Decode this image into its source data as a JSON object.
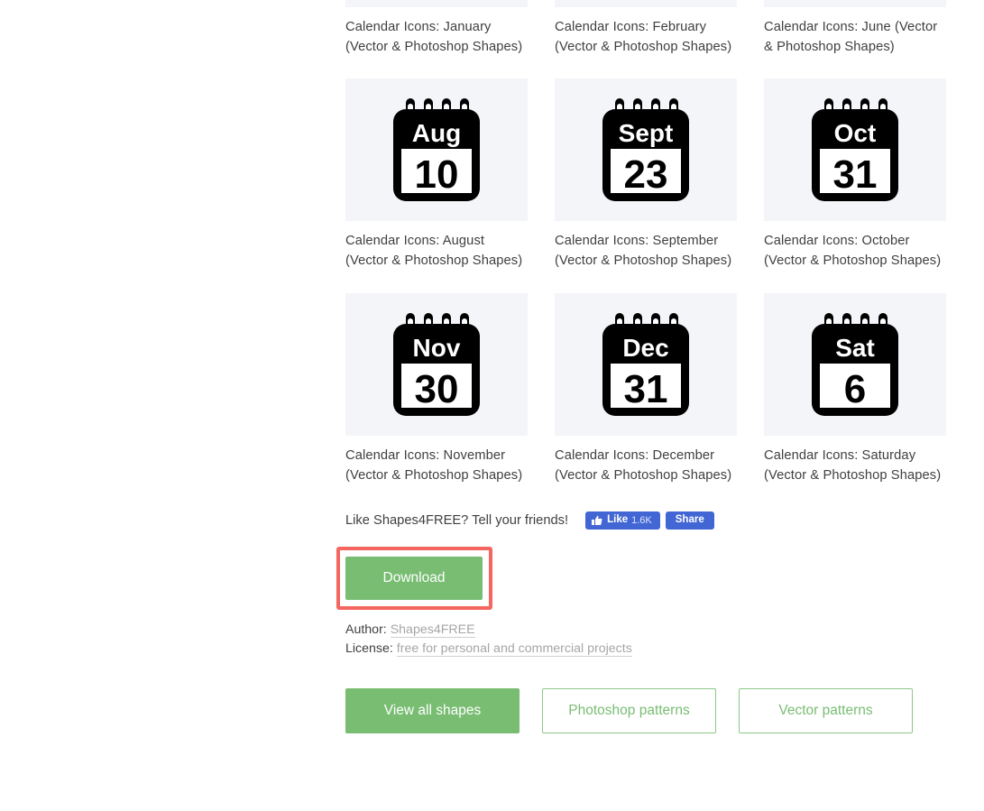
{
  "colors": {
    "green": "#78bd72",
    "green_outline_text": "#79bd73",
    "annotation_red": "#f4665f",
    "facebook_blue": "#4267d4",
    "thumb_bg": "#f4f5f8",
    "text": "#3f3f3f",
    "link_gray": "#a6a6a6"
  },
  "grid": {
    "clipped_row_captions": [
      "Calendar Icons: January (Vector & Photoshop Shapes)",
      "Calendar Icons: February (Vector & Photoshop Shapes)",
      "Calendar Icons: June (Vector & Photoshop Shapes)"
    ],
    "rows": [
      {
        "items": [
          {
            "month": "Aug",
            "day": "10",
            "caption": "Calendar Icons: August (Vector & Photoshop Shapes)"
          },
          {
            "month": "Sept",
            "day": "23",
            "caption": "Calendar Icons: September (Vector & Photoshop Shapes)"
          },
          {
            "month": "Oct",
            "day": "31",
            "caption": "Calendar Icons: October (Vector & Photoshop Shapes)"
          }
        ]
      },
      {
        "items": [
          {
            "month": "Nov",
            "day": "30",
            "caption": "Calendar Icons: November (Vector & Photoshop Shapes)"
          },
          {
            "month": "Dec",
            "day": "31",
            "caption": "Calendar Icons: December (Vector & Photoshop Shapes)"
          },
          {
            "month": "Sat",
            "day": "6",
            "caption": "Calendar Icons: Saturday (Vector & Photoshop Shapes)"
          }
        ]
      }
    ]
  },
  "social": {
    "prompt": "Like Shapes4FREE? Tell your friends!",
    "like_label": "Like",
    "like_count": "1.6K",
    "share_label": "Share",
    "thumbs_up_icon": "thumbs-up-icon"
  },
  "download": {
    "label": "Download"
  },
  "meta": {
    "author_label": "Author:",
    "author_value": "Shapes4FREE",
    "license_label": "License:",
    "license_value": "free for personal and commercial projects"
  },
  "footer": {
    "view_all": "View all shapes",
    "photoshop_patterns": "Photoshop patterns",
    "vector_patterns": "Vector patterns"
  }
}
